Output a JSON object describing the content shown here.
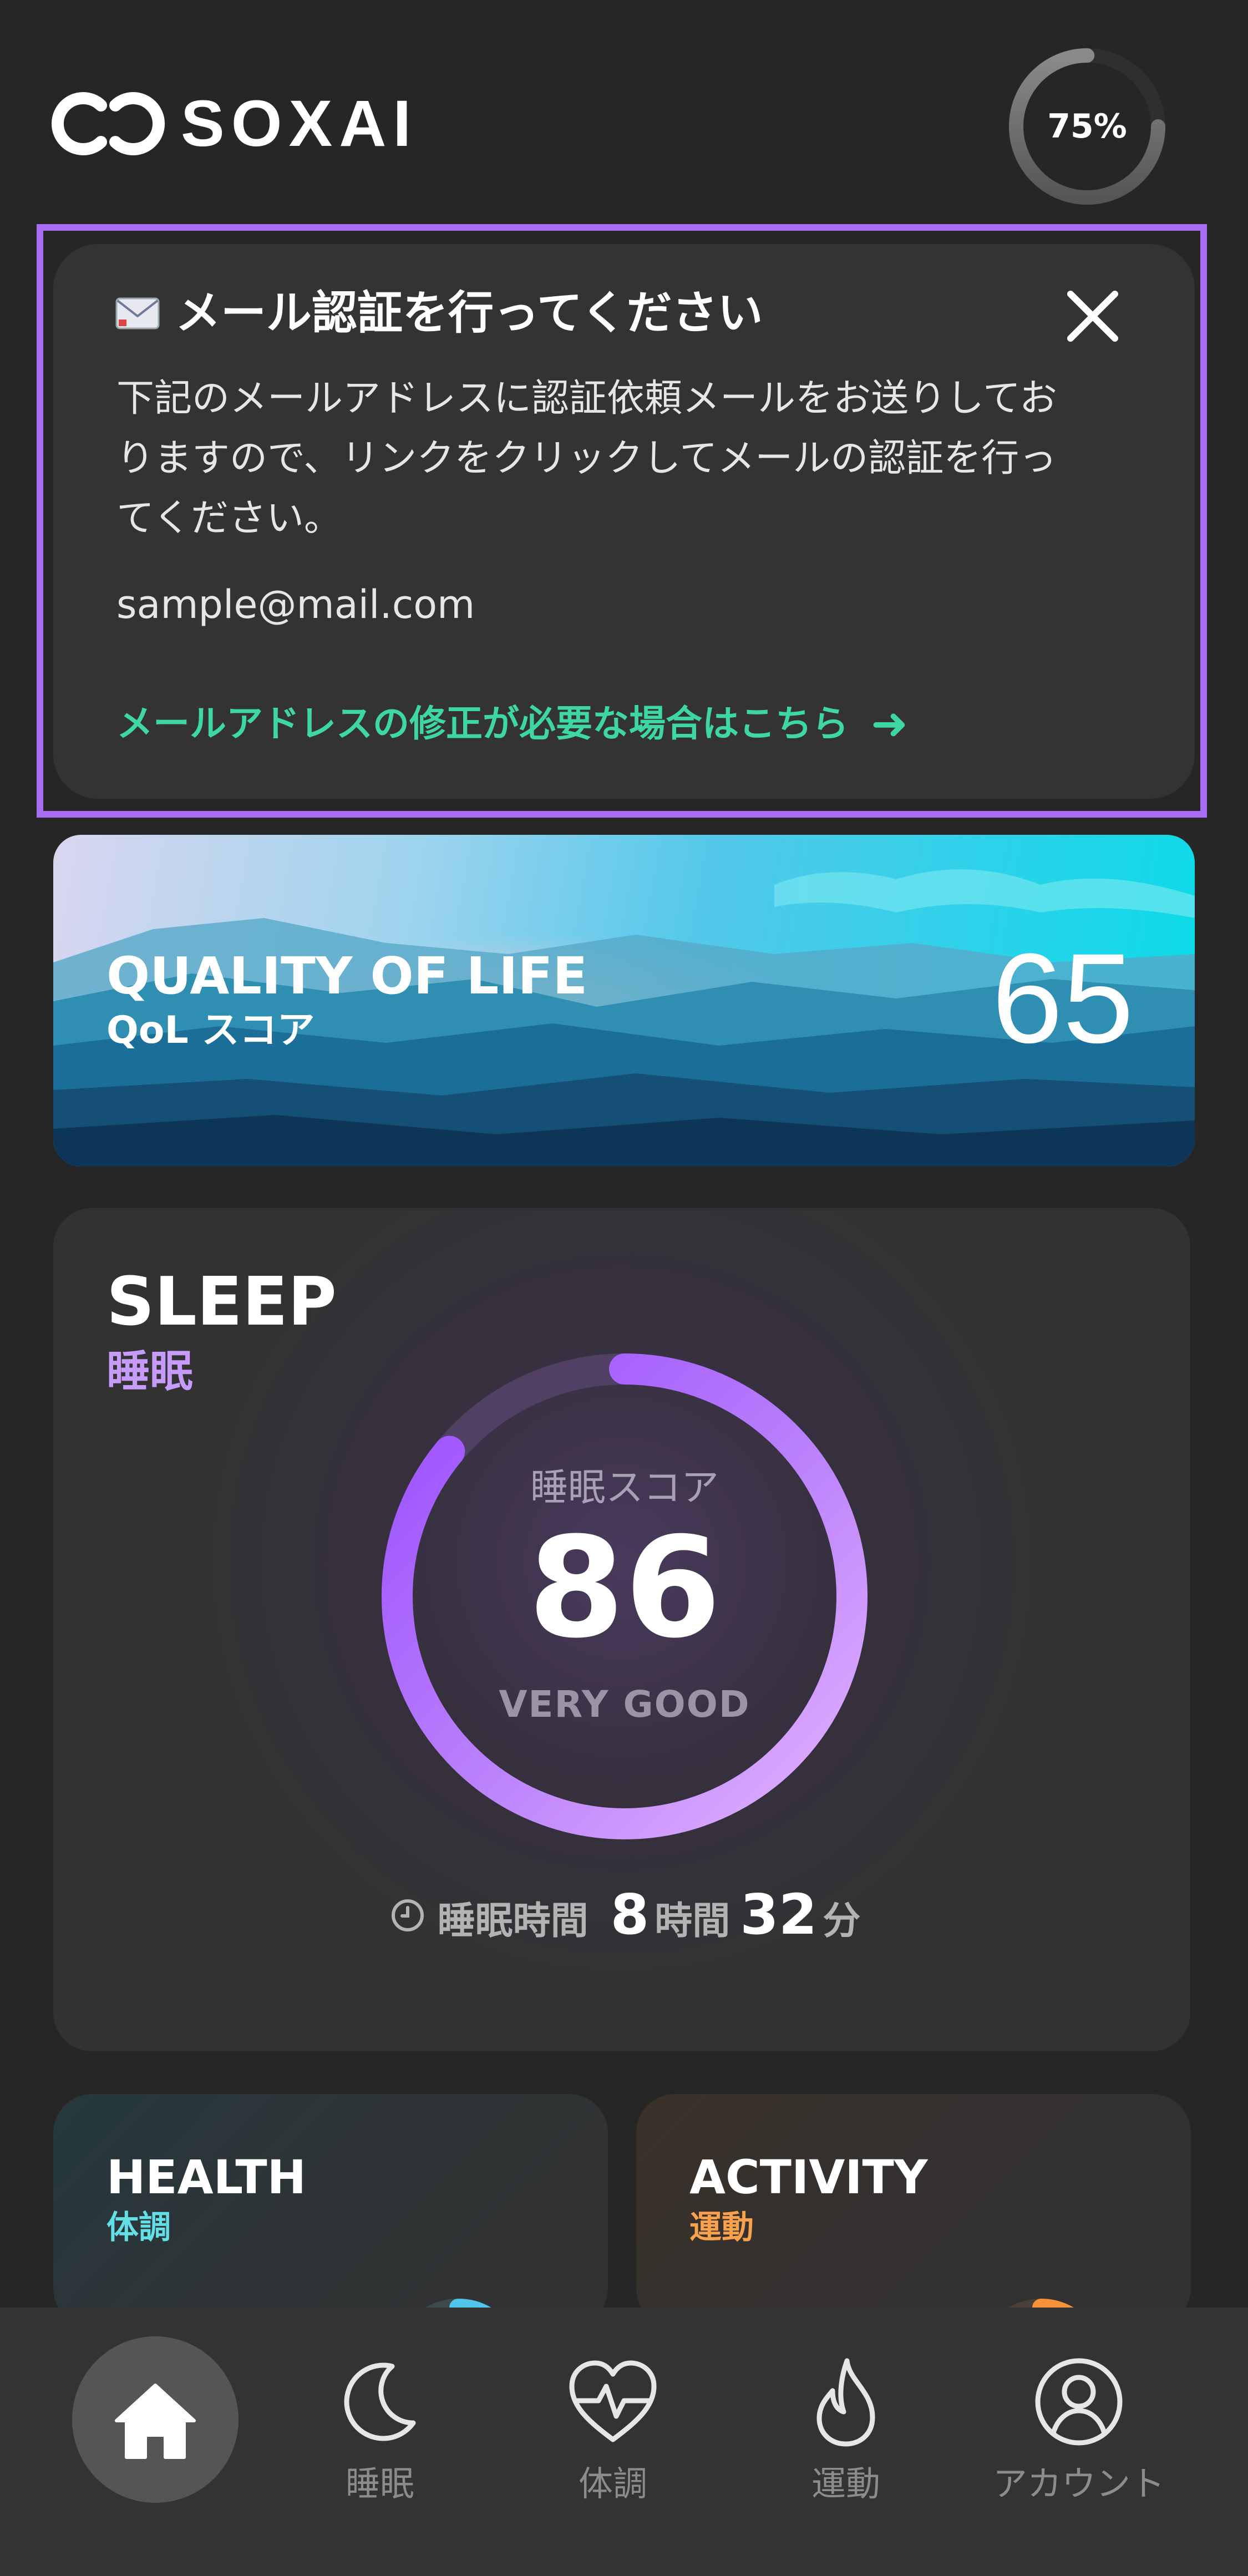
{
  "header": {
    "logo_text": "SOXAI",
    "battery_label": "75%",
    "battery_level": 0.75
  },
  "notice": {
    "title": "メール認証を行ってください",
    "body": "下記のメールアドレスに認証依頼メールをお送りしておりますので、リンクをクリックしてメールの認証を行ってください。",
    "email": "sample@mail.com",
    "link_text": "メールアドレスの修正が必要な場合はこちら",
    "link_arrow": "➜"
  },
  "qol": {
    "title": "QUALITY OF LIFE",
    "subtitle": "QoL スコア",
    "score": "65"
  },
  "sleep": {
    "title": "SLEEP",
    "subtitle": "睡眠",
    "score_label": "睡眠スコア",
    "score": "86",
    "score_fraction": 0.86,
    "grade": "VERY GOOD",
    "duration_label": "睡眠時間",
    "hours": "8",
    "hours_unit": "時間",
    "minutes": "32",
    "minutes_unit": "分"
  },
  "health": {
    "title": "HEALTH",
    "subtitle": "体調"
  },
  "activity": {
    "title": "ACTIVITY",
    "subtitle": "運動"
  },
  "nav": {
    "items": [
      {
        "label": "睡眠",
        "icon": "moon-icon"
      },
      {
        "label": "体調",
        "icon": "heart-pulse-icon"
      },
      {
        "label": "運動",
        "icon": "flame-icon"
      },
      {
        "label": "アカウント",
        "icon": "account-icon"
      }
    ]
  },
  "colors": {
    "background": "#262626",
    "card": "#333333",
    "notice_outline": "#a86cf5",
    "link_green": "#3fd7a1",
    "sleep_purple": "#c79bfb",
    "health_cyan": "#64dfe6",
    "activity_orange": "#f9a24b"
  }
}
